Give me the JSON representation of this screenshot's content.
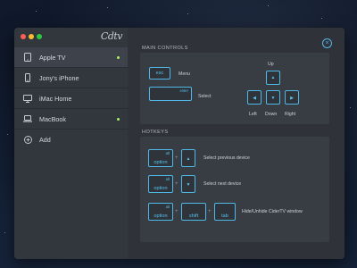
{
  "window": {
    "logo": "Cdtv",
    "traffic_lights": [
      "#fd5f57",
      "#fcbc2e",
      "#2ac840"
    ]
  },
  "sidebar": {
    "items": [
      {
        "label": "Apple TV",
        "icon": "tablet-icon",
        "selected": true,
        "online": true
      },
      {
        "label": "Jony's iPhone",
        "icon": "phone-icon",
        "selected": false,
        "online": false
      },
      {
        "label": "iMac Home",
        "icon": "monitor-icon",
        "selected": false,
        "online": false
      },
      {
        "label": "MacBook",
        "icon": "laptop-icon",
        "selected": false,
        "online": true
      },
      {
        "label": "Add",
        "icon": "plus-circle-icon",
        "selected": false,
        "online": false
      }
    ]
  },
  "main_controls": {
    "title": "MAIN CONTROLS",
    "menu": {
      "key": "esc",
      "label": "Menu"
    },
    "select": {
      "key": "enter",
      "label": "Select"
    },
    "arrows": {
      "up": "Up",
      "left": "Left",
      "down": "Down",
      "right": "Right"
    }
  },
  "hotkeys": {
    "title": "HOTKEYS",
    "rows": [
      {
        "label": "Select previous device",
        "alt": "alt",
        "mod": "option",
        "arrow": "up"
      },
      {
        "label": "Select next device",
        "alt": "alt",
        "mod": "option",
        "arrow": "down"
      },
      {
        "label": "Hide/Unhide CiderTV window",
        "alt": "alt",
        "mod": "option",
        "shift": "shift",
        "tab": "tab"
      }
    ],
    "plus": "+"
  },
  "colors": {
    "accent": "#4fb8e6",
    "online": "#a8f06a"
  }
}
